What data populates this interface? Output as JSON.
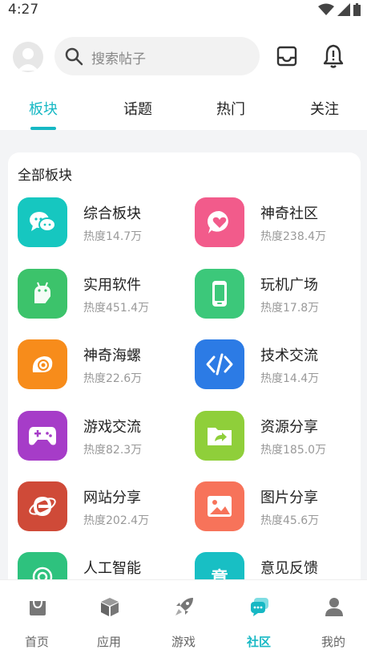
{
  "status_bar": {
    "time": "4:27"
  },
  "header": {
    "search_placeholder": "搜索帖子",
    "tabs": [
      {
        "label": "板块",
        "active": true
      },
      {
        "label": "话题",
        "active": false
      },
      {
        "label": "热门",
        "active": false
      },
      {
        "label": "关注",
        "active": false
      }
    ]
  },
  "section": {
    "title": "全部板块",
    "boards": [
      {
        "name": "综合板块",
        "heat": "热度14.7万",
        "color": "#16c7c0",
        "icon": "chat-bubbles-icon"
      },
      {
        "name": "神奇社区",
        "heat": "热度238.4万",
        "color": "#f25b8b",
        "icon": "heart-bubble-icon"
      },
      {
        "name": "实用软件",
        "heat": "热度451.4万",
        "color": "#3cc36b",
        "icon": "android-icon"
      },
      {
        "name": "玩机广场",
        "heat": "热度17.8万",
        "color": "#3cc87a",
        "icon": "phone-icon"
      },
      {
        "name": "神奇海螺",
        "heat": "热度22.6万",
        "color": "#f78c1b",
        "icon": "conch-icon"
      },
      {
        "name": "技术交流",
        "heat": "热度14.4万",
        "color": "#2c7be5",
        "icon": "code-icon"
      },
      {
        "name": "游戏交流",
        "heat": "热度82.3万",
        "color": "#a63cc8",
        "icon": "gamepad-icon"
      },
      {
        "name": "资源分享",
        "heat": "热度185.0万",
        "color": "#8fcf3a",
        "icon": "folder-share-icon"
      },
      {
        "name": "网站分享",
        "heat": "热度202.4万",
        "color": "#cf4a38",
        "icon": "browser-e-icon"
      },
      {
        "name": "图片分享",
        "heat": "热度45.6万",
        "color": "#f7735a",
        "icon": "image-icon"
      },
      {
        "name": "人工智能",
        "heat": "",
        "color": "#2ec27e",
        "icon": "ai-icon"
      },
      {
        "name": "意见反馈",
        "heat": "",
        "color": "#18bfc4",
        "icon": "feedback-icon",
        "glyph": "意"
      }
    ]
  },
  "bottom_nav": [
    {
      "label": "首页",
      "icon": "home-bag-icon",
      "active": false
    },
    {
      "label": "应用",
      "icon": "cube-icon",
      "active": false
    },
    {
      "label": "游戏",
      "icon": "rocket-icon",
      "active": false
    },
    {
      "label": "社区",
      "icon": "community-icon",
      "active": true
    },
    {
      "label": "我的",
      "icon": "user-icon",
      "active": false
    }
  ],
  "colors": {
    "accent": "#16b8c4"
  }
}
